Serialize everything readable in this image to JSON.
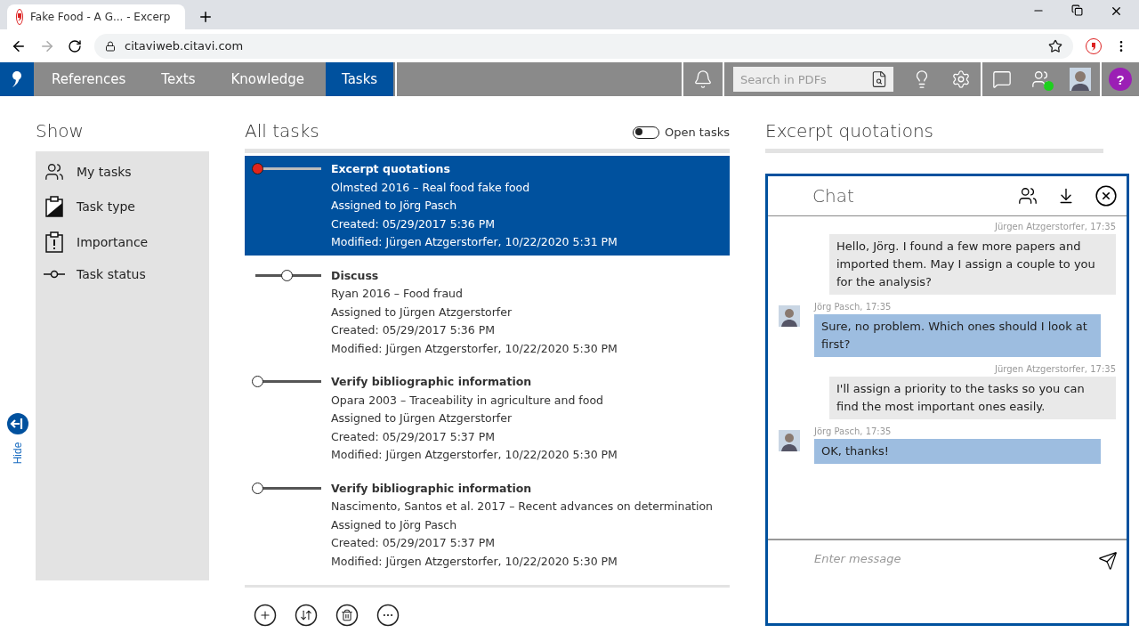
{
  "browser": {
    "tab_title": "Fake Food - A G... - Excerp",
    "url": "citaviweb.citavi.com"
  },
  "nav": {
    "items": [
      {
        "label": "References",
        "selected": false
      },
      {
        "label": "Texts",
        "selected": false
      },
      {
        "label": "Knowledge",
        "selected": false
      },
      {
        "label": "Tasks",
        "selected": true
      }
    ],
    "search": {
      "placeholder": "Search in PDFs"
    },
    "help": "?"
  },
  "sidebar": {
    "title": "Show",
    "items": [
      {
        "kind": "people",
        "label": "My tasks"
      },
      {
        "kind": "type",
        "label": "Task type"
      },
      {
        "kind": "importance",
        "label": "Importance"
      },
      {
        "kind": "status",
        "label": "Task status"
      }
    ],
    "hide": "Hide"
  },
  "tasks": {
    "title": "All tasks",
    "filter": {
      "label": "Open tasks",
      "on": false
    },
    "items": [
      {
        "selected": true,
        "level": 0,
        "color": "#e0241b",
        "title": "Excerpt quotations",
        "reference": "Olmsted 2016 – Real food fake food",
        "assigned": "Assigned to Jörg Pasch",
        "created": "Created: 05/29/2017 5:36 PM",
        "modified": "Modified: Jürgen Atzgerstorfer, 10/22/2020 5:31 PM"
      },
      {
        "selected": false,
        "level": 0.5,
        "color": "#ffffff",
        "title": "Discuss",
        "reference": "Ryan 2016 – Food fraud",
        "assigned": "Assigned to Jürgen Atzgerstorfer",
        "created": "Created: 05/29/2017 5:36 PM",
        "modified": "Modified: Jürgen Atzgerstorfer, 10/22/2020 5:30 PM"
      },
      {
        "selected": false,
        "level": 0,
        "color": "#ffffff",
        "title": "Verify bibliographic information",
        "reference": "Opara 2003 – Traceability in agriculture and food",
        "assigned": "Assigned to Jürgen Atzgerstorfer",
        "created": "Created: 05/29/2017 5:37 PM",
        "modified": "Modified: Jürgen Atzgerstorfer, 10/22/2020 5:30 PM"
      },
      {
        "selected": false,
        "level": 0,
        "color": "#ffffff",
        "title": "Verify bibliographic information",
        "reference": "Nascimento, Santos et al. 2017 – Recent advances on determination",
        "assigned": "Assigned to Jörg Pasch",
        "created": "Created: 05/29/2017 5:37 PM",
        "modified": "Modified: Jürgen Atzgerstorfer, 10/22/2020 5:30 PM"
      }
    ],
    "toolbar": [
      {
        "kind": "add"
      },
      {
        "kind": "sort"
      },
      {
        "kind": "delete"
      },
      {
        "kind": "more"
      }
    ]
  },
  "detail": {
    "title": "Excerpt quotations"
  },
  "chat": {
    "title": "Chat",
    "messages": [
      {
        "kind": "outgoing",
        "meta": "Jürgen Atzgerstorfer, 17:35",
        "text": "Hello, Jörg. I found a few more papers and imported them. May I assign a couple to you for the analysis?"
      },
      {
        "kind": "incoming",
        "meta": "Jörg Pasch, 17:35",
        "text": "Sure, no problem. Which ones should I look at first?"
      },
      {
        "kind": "outgoing",
        "meta": "Jürgen Atzgerstorfer, 17:35",
        "text": "I'll assign a priority to the tasks so you can find the most important ones easily."
      },
      {
        "kind": "incoming",
        "meta": "Jörg Pasch, 17:35",
        "text": "OK, thanks!"
      }
    ],
    "input": {
      "placeholder": "Enter message"
    }
  }
}
